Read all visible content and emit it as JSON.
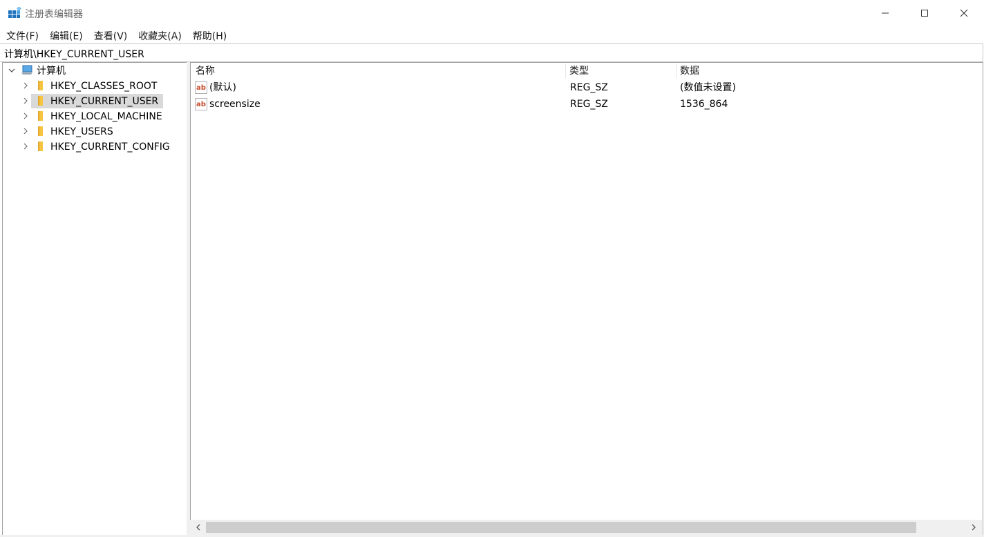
{
  "window": {
    "title": "注册表编辑器",
    "controls": {
      "minimize": "—",
      "maximize": "☐",
      "close": "✕"
    }
  },
  "menu": {
    "items": [
      "文件(F)",
      "编辑(E)",
      "查看(V)",
      "收藏夹(A)",
      "帮助(H)"
    ]
  },
  "address": {
    "path": "计算机\\HKEY_CURRENT_USER"
  },
  "tree": {
    "root": {
      "label": "计算机",
      "icon": "computer-icon",
      "expanded": true
    },
    "items": [
      {
        "label": "HKEY_CLASSES_ROOT",
        "icon": "folder-icon",
        "selected": false
      },
      {
        "label": "HKEY_CURRENT_USER",
        "icon": "folder-icon",
        "selected": true
      },
      {
        "label": "HKEY_LOCAL_MACHINE",
        "icon": "folder-icon",
        "selected": false
      },
      {
        "label": "HKEY_USERS",
        "icon": "folder-icon",
        "selected": false
      },
      {
        "label": "HKEY_CURRENT_CONFIG",
        "icon": "folder-icon",
        "selected": false
      }
    ]
  },
  "list": {
    "columns": {
      "name": "名称",
      "type": "类型",
      "data": "数据"
    },
    "rows": [
      {
        "name": "(默认)",
        "type": "REG_SZ",
        "data": "(数值未设置)",
        "icon": "string-value-icon"
      },
      {
        "name": "screensize",
        "type": "REG_SZ",
        "data": "1536_864",
        "icon": "string-value-icon"
      }
    ]
  },
  "scrollbar": {
    "left_arrow": "<",
    "right_arrow": ">"
  },
  "colors": {
    "selection": "#d9d9d9",
    "folder": "#f5c542",
    "string_icon": "#c84a2c",
    "border": "#a0a0a0"
  }
}
